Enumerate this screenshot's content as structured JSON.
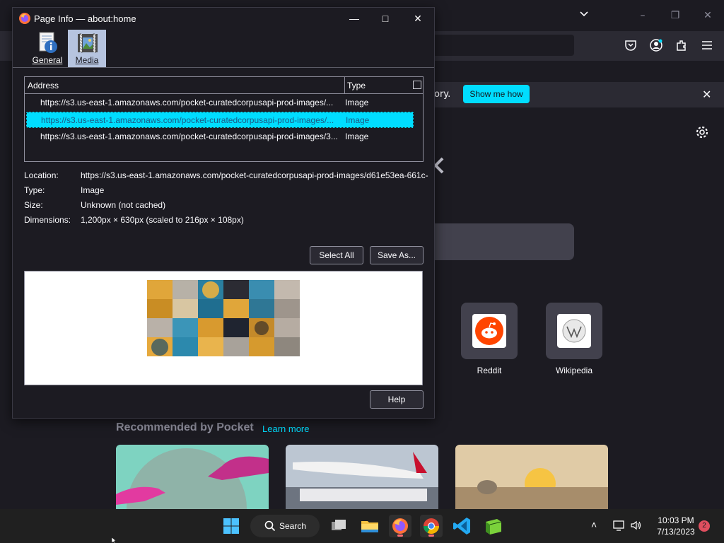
{
  "background_firefox": {
    "notification_text": "ory.",
    "notification_button": "Show me how",
    "close_glyph": "✕",
    "shortcuts": [
      {
        "label": "Reddit",
        "icon": "reddit-icon",
        "color": "#ff4500"
      },
      {
        "label": "Wikipedia",
        "icon": "wikipedia-icon",
        "color": "#ffffff"
      }
    ],
    "pocket_heading": "Recommended by Pocket",
    "pocket_learn_more": "Learn more",
    "window_controls": {
      "minimize": "–",
      "maximize": "❐",
      "close": "✕"
    }
  },
  "dialog": {
    "title": "Page Info — about:home",
    "controls": {
      "minimize": "—",
      "maximize": "□",
      "close": "✕"
    },
    "tabs": [
      {
        "label": "General",
        "icon": "general-info-icon",
        "active": false
      },
      {
        "label": "Media",
        "icon": "media-icon",
        "active": true
      }
    ],
    "table": {
      "columns": [
        "Address",
        "Type"
      ],
      "rows": [
        {
          "address": "https://s3.us-east-1.amazonaws.com/pocket-curatedcorpusapi-prod-images/...",
          "type": "Image",
          "selected": false
        },
        {
          "address": "https://s3.us-east-1.amazonaws.com/pocket-curatedcorpusapi-prod-images/...",
          "type": "Image",
          "selected": true
        },
        {
          "address": "https://s3.us-east-1.amazonaws.com/pocket-curatedcorpusapi-prod-images/3...",
          "type": "Image",
          "selected": false
        }
      ]
    },
    "properties": [
      {
        "key": "Location:",
        "value": "https://s3.us-east-1.amazonaws.com/pocket-curatedcorpusapi-prod-images/d61e53ea-661c-"
      },
      {
        "key": "Type:",
        "value": "Image"
      },
      {
        "key": "Size:",
        "value": "Unknown (not cached)"
      },
      {
        "key": "Dimensions:",
        "value": "1,200px × 630px (scaled to 216px × 108px)"
      }
    ],
    "buttons": {
      "select_all": "Select All",
      "save_as": "Save As...",
      "help": "Help"
    },
    "accent": "#00ddff"
  },
  "taskbar": {
    "search_label": "Search",
    "apps": [
      "windows-start-icon",
      "search",
      "task-view-icon",
      "file-explorer-icon",
      "firefox-icon",
      "chrome-icon",
      "vscode-icon",
      "minecraft-icon"
    ],
    "time": "10:03 PM",
    "date": "7/13/2023",
    "notification_count": "2",
    "tray_chevron": "˄"
  }
}
